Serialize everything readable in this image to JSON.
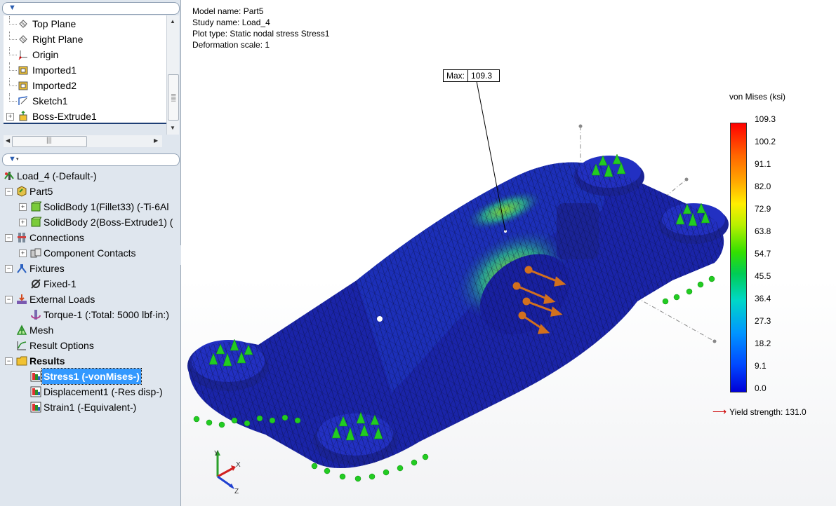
{
  "tree_top": [
    {
      "label": "Top Plane",
      "icon": "plane-icon",
      "toggle": false
    },
    {
      "label": "Right Plane",
      "icon": "plane-icon",
      "toggle": false
    },
    {
      "label": "Origin",
      "icon": "origin-icon",
      "toggle": false
    },
    {
      "label": "Imported1",
      "icon": "imported-body-icon",
      "toggle": false
    },
    {
      "label": "Imported2",
      "icon": "imported-body-icon",
      "toggle": false
    },
    {
      "label": "Sketch1",
      "icon": "sketch-icon",
      "toggle": false
    },
    {
      "label": "Boss-Extrude1",
      "icon": "boss-extrude-icon",
      "toggle": "+"
    }
  ],
  "study_tree": {
    "study": "Load_4 (-Default-)",
    "part": "Part5",
    "solid_bodies": [
      "SolidBody 1(Fillet33) (-Ti-6Al",
      "SolidBody 2(Boss-Extrude1) ("
    ],
    "connections": "Connections",
    "component_contacts": "Component Contacts",
    "fixtures": "Fixtures",
    "fixed": "Fixed-1",
    "external_loads": "External Loads",
    "torque": "Torque-1 (:Total: 5000 lbf·in:)",
    "mesh": "Mesh",
    "result_options": "Result Options",
    "results": "Results",
    "result_items": [
      "Stress1 (-vonMises-)",
      "Displacement1 (-Res disp-)",
      "Strain1 (-Equivalent-)"
    ]
  },
  "plot_info": {
    "model_name": "Model name: Part5",
    "study_name": "Study name: Load_4",
    "plot_type": "Plot type: Static nodal stress Stress1",
    "deformation_scale": "Deformation scale: 1"
  },
  "max_probe": {
    "label": "Max:",
    "value": "109.3"
  },
  "legend": {
    "title": "von Mises (ksi)",
    "ticks": [
      "109.3",
      "100.2",
      "91.1",
      "82.0",
      "72.9",
      "63.8",
      "54.7",
      "45.5",
      "36.4",
      "27.3",
      "18.2",
      "9.1",
      "0.0"
    ],
    "yield_strength": "Yield strength: 131.0",
    "yield_color": "#cc0000"
  },
  "triad": {
    "x": "X",
    "y": "Y",
    "z": "Z"
  },
  "colors": {
    "mesh_base": "#1a24a8",
    "fixture_green": "#22cc22",
    "load_arrow": "#d2701e"
  }
}
